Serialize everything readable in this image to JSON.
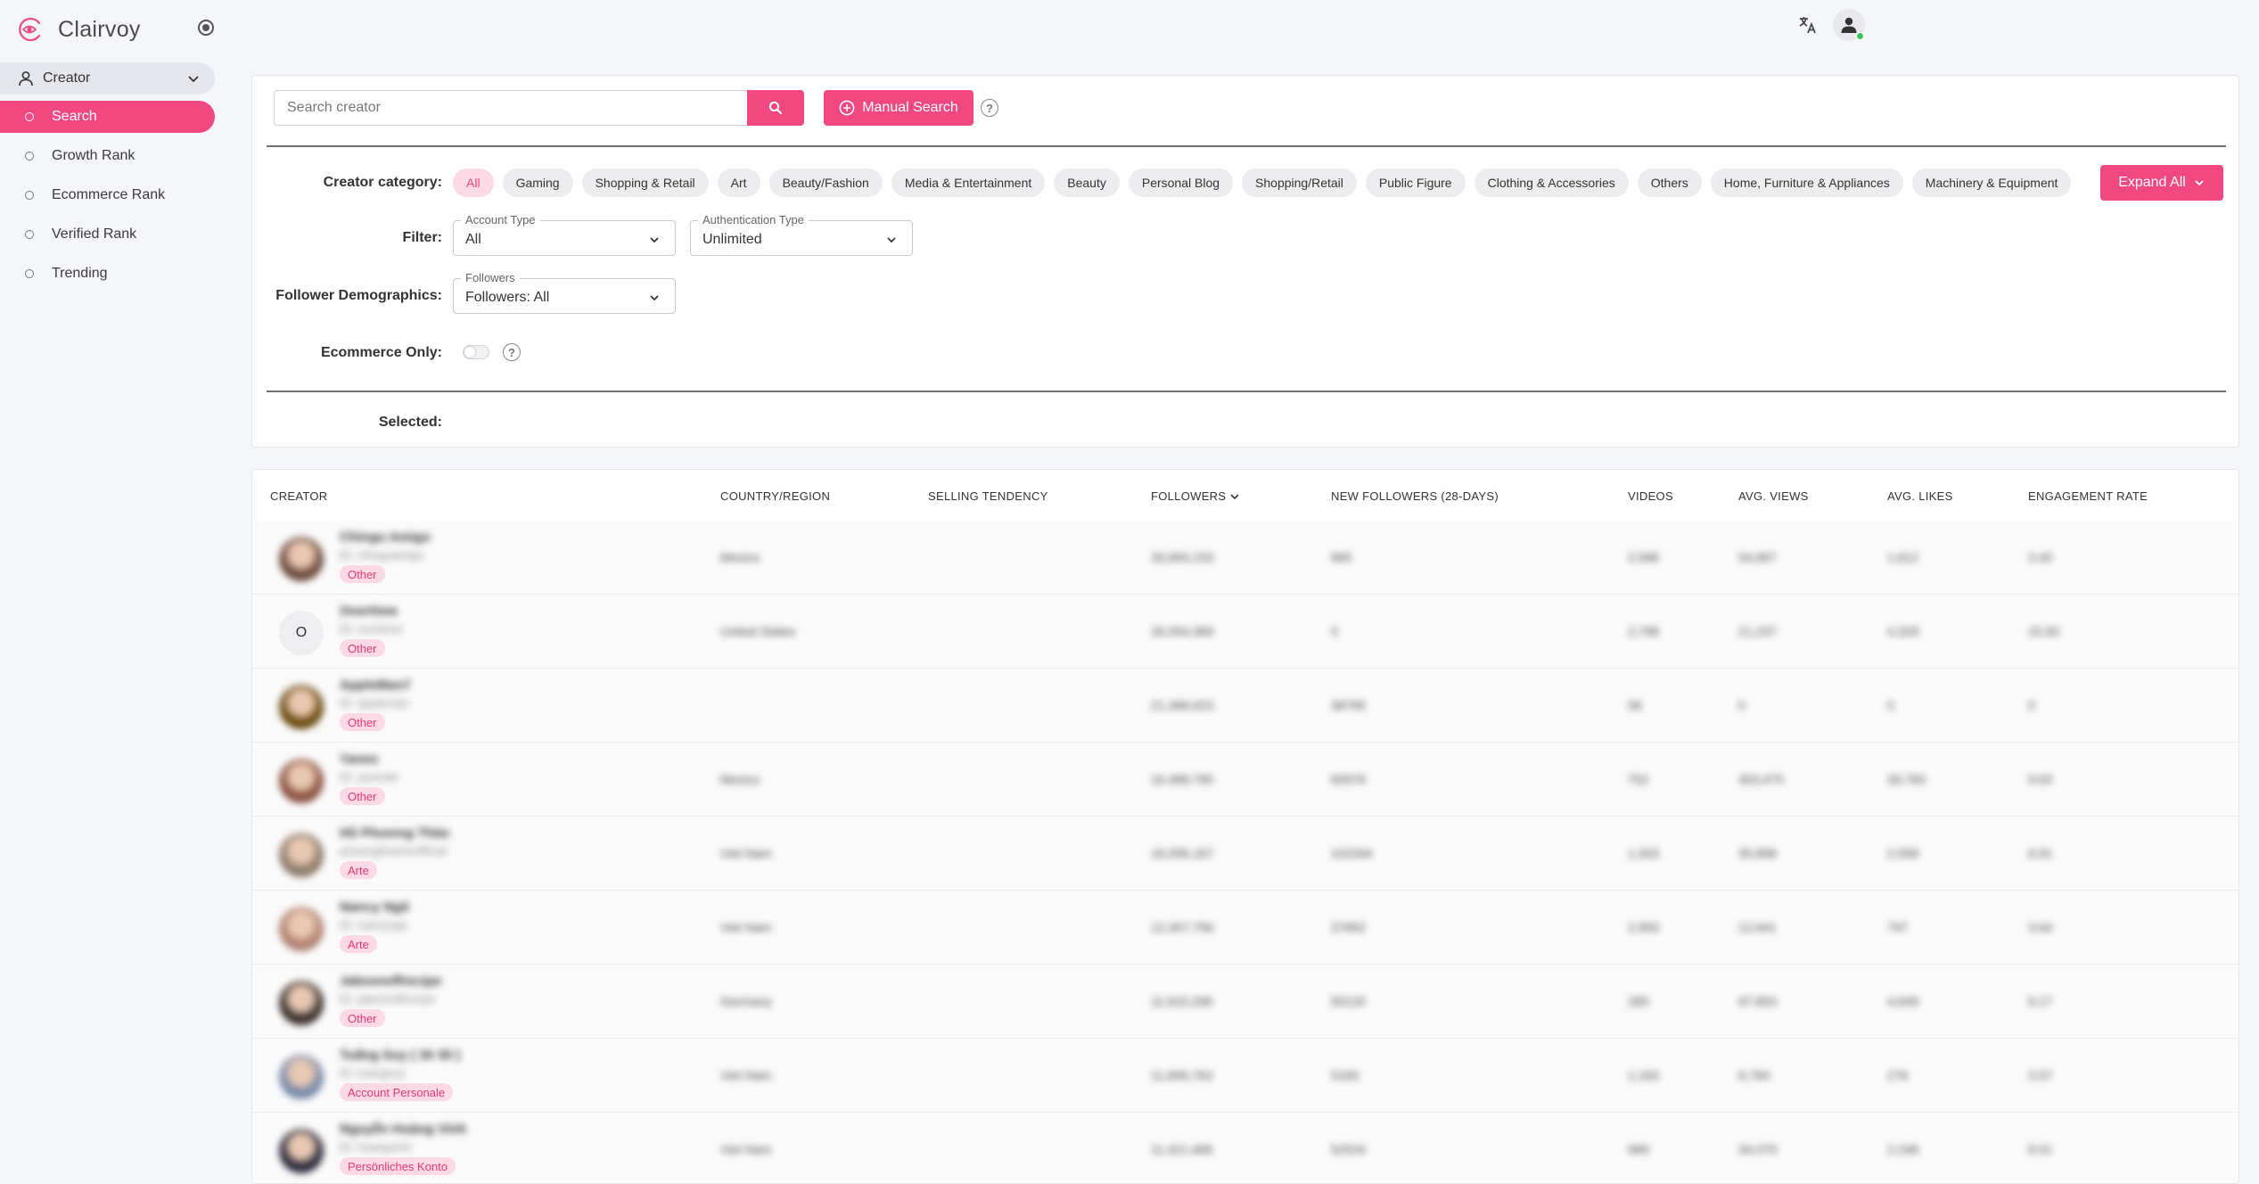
{
  "app": {
    "name": "Clairvoy"
  },
  "sidebar": {
    "group_label": "Creator",
    "items": [
      {
        "label": "Search",
        "active": true
      },
      {
        "label": "Growth Rank",
        "active": false
      },
      {
        "label": "Ecommerce Rank",
        "active": false
      },
      {
        "label": "Verified Rank",
        "active": false
      },
      {
        "label": "Trending",
        "active": false
      }
    ]
  },
  "search": {
    "placeholder": "Search creator",
    "value": "",
    "manual_label": "Manual Search"
  },
  "filters": {
    "category_label": "Creator category:",
    "categories": [
      "All",
      "Gaming",
      "Shopping & Retail",
      "Art",
      "Beauty/Fashion",
      "Media & Entertainment",
      "Beauty",
      "Personal Blog",
      "Shopping/Retail",
      "Public Figure",
      "Clothing & Accessories",
      "Others",
      "Home, Furniture & Appliances",
      "Machinery & Equipment"
    ],
    "active_category": "All",
    "expand_label": "Expand All",
    "filter_label": "Filter:",
    "account_type": {
      "legend": "Account Type",
      "value": "All"
    },
    "auth_type": {
      "legend": "Authentication Type",
      "value": "Unlimited"
    },
    "demographics_label": "Follower Demographics:",
    "followers": {
      "legend": "Followers",
      "value": "Followers: All"
    },
    "ecommerce_label": "Ecommerce Only:",
    "ecommerce_only": false,
    "selected_label": "Selected:"
  },
  "table": {
    "columns": {
      "creator": "CREATOR",
      "country": "COUNTRY/REGION",
      "selling": "SELLING TENDENCY",
      "followers": "FOLLOWERS",
      "new_followers": "NEW FOLLOWERS (28-DAYS)",
      "videos": "VIDEOS",
      "avg_views": "AVG. VIEWS",
      "avg_likes": "AVG. LIKES",
      "engagement": "ENGAGEMENT RATE"
    },
    "rows": [
      {
        "name": "Chingu Amigo",
        "handle": "ID: chinguamigo",
        "tag": "Other",
        "avatar_letter": "",
        "avatar_color": "#6b4a3c",
        "country": "Mexico",
        "followers": "26,893,153",
        "new_followers": "965",
        "videos": "2,586",
        "avg_views": "54,897",
        "avg_likes": "1,612",
        "engagement": "3.45"
      },
      {
        "name": "Overtime",
        "handle": "ID: overtime",
        "tag": "Other",
        "avatar_letter": "O",
        "avatar_color": "#eeeef1",
        "country": "United States",
        "followers": "26,054,369",
        "new_followers": "0",
        "videos": "2,798",
        "avg_views": "21,237",
        "avg_likes": "4,329",
        "engagement": "15.83"
      },
      {
        "name": "AppleMan7",
        "handle": "ID: appleman",
        "tag": "Other",
        "avatar_letter": "",
        "avatar_color": "#6a4a10",
        "country": "",
        "followers": "21,396,623",
        "new_followers": "38795",
        "videos": "56",
        "avg_views": "0",
        "avg_likes": "0",
        "engagement": "0"
      },
      {
        "name": "Yanes",
        "handle": "ID: yanesbr",
        "tag": "Other",
        "avatar_letter": "",
        "avatar_color": "#8a5040",
        "country": "Mexico",
        "followers": "16,488,795",
        "new_followers": "60976",
        "videos": "752",
        "avg_views": "303,475",
        "avg_likes": "26,783",
        "engagement": "9.63"
      },
      {
        "name": "Hồ Phương Thảo",
        "handle": "phuongthaohoofficial",
        "tag": "Arte",
        "avatar_letter": "",
        "avatar_color": "#8c7a6a",
        "country": "Viet Nam",
        "followers": "16,056,167",
        "new_followers": "102344",
        "videos": "1,303",
        "avg_views": "35,898",
        "avg_likes": "2,058",
        "engagement": "8.91"
      },
      {
        "name": "Nancy Ngô",
        "handle": "ID: nancyngo",
        "tag": "Arte",
        "avatar_letter": "",
        "avatar_color": "#b08070",
        "country": "Viet Nam",
        "followers": "12,357,756",
        "new_followers": "37852",
        "videos": "2,953",
        "avg_views": "12,641",
        "avg_likes": "797",
        "engagement": "3.64"
      },
      {
        "name": "Jakesnoffrecipe",
        "handle": "ID: jakesnoffrecipe",
        "tag": "Other",
        "avatar_letter": "",
        "avatar_color": "#3a302c",
        "country": "Germany",
        "followers": "11,615,296",
        "new_followers": "50120",
        "videos": "285",
        "avg_views": "97,853",
        "avg_likes": "4,649",
        "engagement": "8.17"
      },
      {
        "name": "Tuấng Suy ( 30 30 )",
        "handle": "ID: tuangsuy",
        "tag": "Account Personale",
        "avatar_letter": "",
        "avatar_color": "#7a8aaa",
        "country": "Viet Nam",
        "followers": "11,806,763",
        "new_followers": "5183",
        "videos": "1,163",
        "avg_views": "8,784",
        "avg_likes": "276",
        "engagement": "3.57"
      },
      {
        "name": "Nguyễn Hoàng Vinh",
        "handle": "ID: hoangvinh",
        "tag": "Persönliches Konto",
        "avatar_letter": "",
        "avatar_color": "#2a2a3a",
        "country": "Viet Nam",
        "followers": "11,421,468",
        "new_followers": "52524",
        "videos": "989",
        "avg_views": "34,079",
        "avg_likes": "2,248",
        "engagement": "8.01"
      }
    ]
  },
  "colors": {
    "accent": "#f0487f",
    "chip_active_bg": "#fcd9e5",
    "online": "#39c35a"
  },
  "icons": [
    "brand-logo-icon",
    "collapse-icon",
    "person-icon",
    "chevron-down-icon",
    "radio-ring-icon",
    "translate-icon",
    "user-icon",
    "search-icon",
    "add-circle-icon",
    "help-icon"
  ]
}
